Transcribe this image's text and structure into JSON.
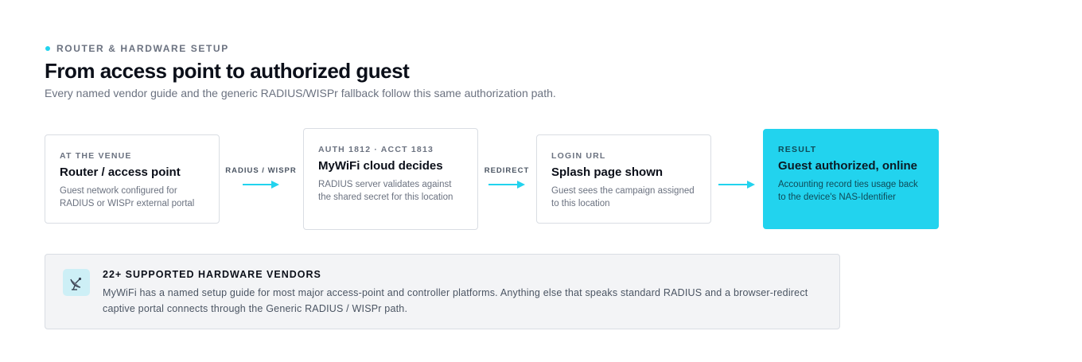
{
  "header": {
    "eyebrow": "ROUTER & HARDWARE SETUP",
    "title": "From access point to authorized guest",
    "subtitle": "Every named vendor guide and the generic RADIUS/WISPr fallback follow this same authorization path."
  },
  "steps": [
    {
      "kicker": "AT THE VENUE",
      "heading": "Router / access point",
      "detail": "Guest network configured for RADIUS or WISPr external portal"
    },
    {
      "kicker": "AUTH 1812 · ACCT 1813",
      "heading": "MyWiFi cloud decides",
      "detail": "RADIUS server validates against the shared secret for this location"
    },
    {
      "kicker": "LOGIN URL",
      "heading": "Splash page shown",
      "detail": "Guest sees the campaign assigned to this location"
    },
    {
      "kicker": "RESULT",
      "heading": "Guest authorized, online",
      "detail": "Accounting record ties usage back to the device's NAS-Identifier"
    }
  ],
  "connectors": [
    {
      "label": "RADIUS / WISPR"
    },
    {
      "label": "REDIRECT"
    },
    {
      "label": ""
    }
  ],
  "vendors": {
    "icon": "satellite-dish-icon",
    "title": "22+ SUPPORTED HARDWARE VENDORS",
    "description": "MyWiFi has a named setup guide for most major access-point and controller platforms. Anything else that speaks standard RADIUS and a browser-redirect captive portal connects through the Generic RADIUS / WISPr path."
  },
  "colors": {
    "accent": "#22d3ee",
    "text": "#0b0f19",
    "muted": "#6b7280",
    "border": "#d9dde3"
  }
}
